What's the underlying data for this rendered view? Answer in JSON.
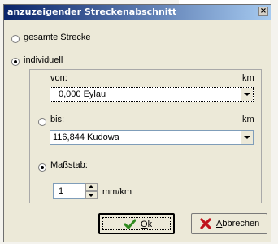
{
  "dialog": {
    "title": "anzuzeigender Streckenabschnitt",
    "close_label": "×",
    "option_full": "gesamte Strecke",
    "option_individual": "individuell",
    "from": {
      "label": "von:",
      "unit": "km",
      "value": "0,000 Eylau"
    },
    "to": {
      "label": "bis:",
      "unit": "km",
      "value": "116,844 Kudowa"
    },
    "scale": {
      "label": "Maßstab:",
      "value": "1",
      "unit": "mm/km"
    },
    "ok": {
      "underline": "O",
      "rest": "k"
    },
    "cancel": {
      "underline": "A",
      "rest": "bbrechen"
    }
  }
}
